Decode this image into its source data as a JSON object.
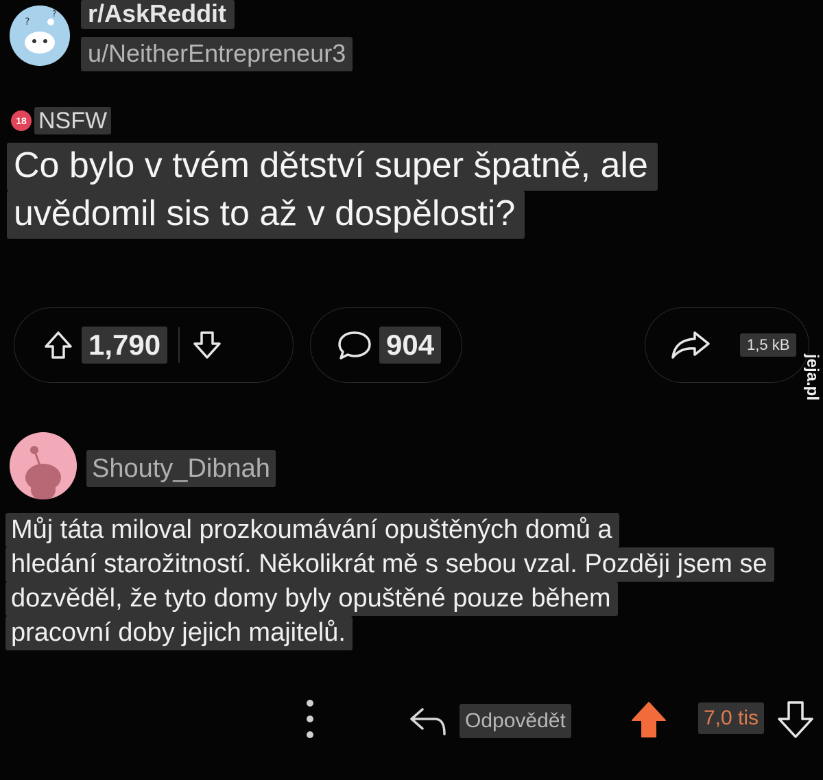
{
  "post": {
    "subreddit": "r/AskReddit",
    "author": "u/NeitherEntrepreneur3",
    "nsfw_badge": "18",
    "nsfw_label": "NSFW",
    "title_lines": [
      "Co bylo v tvém dětství super špatně, ale",
      "uvědomil sis to až v dospělosti?"
    ],
    "upvotes": "1,790",
    "comments": "904",
    "share_size": "1,5 kB"
  },
  "watermark": "jeja.pl",
  "comment": {
    "username": "Shouty_Dibnah",
    "body_lines": [
      "Můj táta miloval prozkoumávání opuštěných domů a",
      "hledání starožitností. Několikrát mě s sebou vzal. Později jsem se",
      "dozvěděl, že tyto domy byly opuštěné pouze během",
      "pracovní doby jejich majitelů."
    ],
    "reply_label": "Odpovědět",
    "score": "7,0 tis"
  },
  "icons": {
    "upvote": "arrow-up-icon",
    "downvote": "arrow-down-icon",
    "comment": "speech-bubble-icon",
    "share": "share-arrow-icon",
    "more": "three-dots-icon",
    "reply": "reply-arrow-icon"
  },
  "colors": {
    "background": "#050505",
    "nsfw": "#e0455a",
    "upvoted": "#f26b3a",
    "score": "#e07b4e"
  }
}
